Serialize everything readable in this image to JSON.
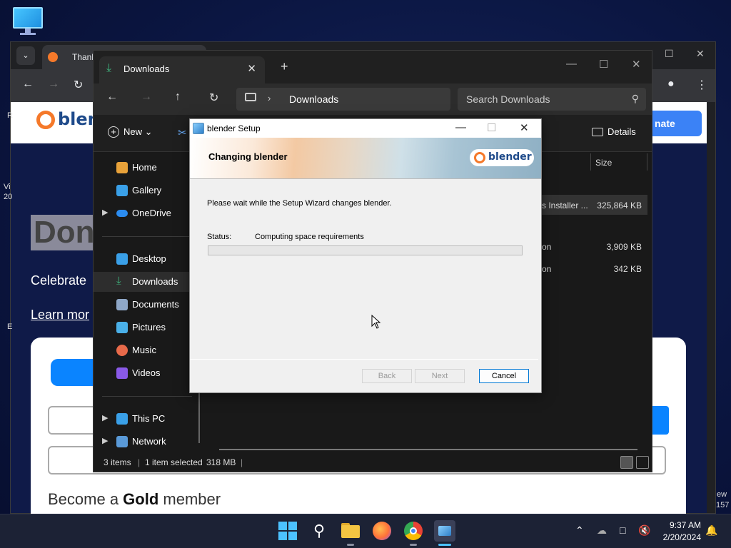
{
  "browser": {
    "tab_title": "Thanks!",
    "page": {
      "logo_text": "blen",
      "donate_label": "nate",
      "heading": "Don",
      "celebrate": "Celebrate",
      "learn_more": "Learn mor",
      "gold_prefix": "Become a ",
      "gold_bold": "Gold",
      "gold_suffix": " member",
      "left_edge_1": "R",
      "left_edge_2": "Vi",
      "left_edge_3": "20",
      "left_edge_4": "E",
      "right_edge_1": "ew",
      "right_edge_2": "157"
    }
  },
  "explorer": {
    "tab_title": "Downloads",
    "path": "Downloads",
    "search_placeholder": "Search Downloads",
    "new_label": "New",
    "details_label": "Details",
    "column_size": "Size",
    "sidebar": [
      {
        "label": "Home",
        "icon": "home-icon"
      },
      {
        "label": "Gallery",
        "icon": "gallery-icon"
      },
      {
        "label": "OneDrive",
        "icon": "onedrive-icon"
      },
      {
        "label": "Desktop",
        "icon": "desktop-icon"
      },
      {
        "label": "Downloads",
        "icon": "downloads-icon"
      },
      {
        "label": "Documents",
        "icon": "documents-icon"
      },
      {
        "label": "Pictures",
        "icon": "pictures-icon"
      },
      {
        "label": "Music",
        "icon": "music-icon"
      },
      {
        "label": "Videos",
        "icon": "videos-icon"
      },
      {
        "label": "This PC",
        "icon": "this-pc-icon"
      },
      {
        "label": "Network",
        "icon": "network-icon"
      }
    ],
    "files": [
      {
        "type": "s Installer ...",
        "size": "325,864 KB"
      },
      {
        "type": "on",
        "size": "3,909 KB"
      },
      {
        "type": "on",
        "size": "342 KB"
      }
    ],
    "status": {
      "count": "3 items",
      "selected": "1 item selected",
      "size": "318 MB"
    }
  },
  "setup": {
    "title": "blender Setup",
    "heading": "Changing blender",
    "logo_text": "blender",
    "description": "Please wait while the Setup Wizard changes blender.",
    "status_label": "Status:",
    "status_value": "Computing space requirements",
    "progress": 0,
    "buttons": {
      "back": "Back",
      "next": "Next",
      "cancel": "Cancel"
    }
  },
  "taskbar": {
    "time": "9:37 AM",
    "date": "2/20/2024"
  }
}
